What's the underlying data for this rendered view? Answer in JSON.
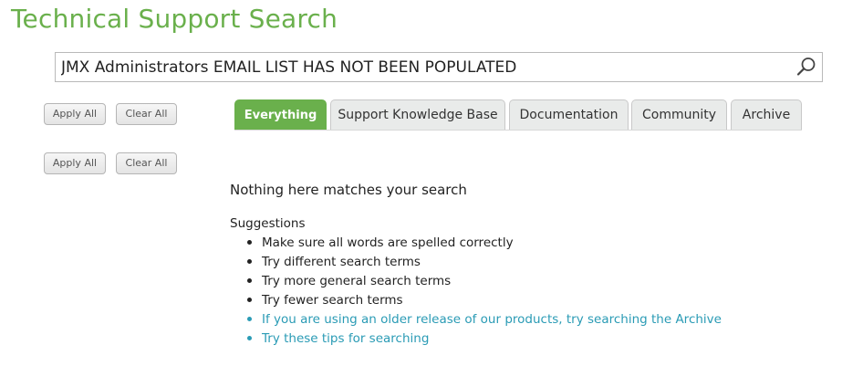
{
  "page": {
    "title": "Technical Support Search"
  },
  "search": {
    "value": "JMX Administrators EMAIL LIST HAS NOT BEEN POPULATED",
    "icon": "search-icon"
  },
  "filters": [
    {
      "apply_label": "Apply All",
      "clear_label": "Clear All"
    },
    {
      "apply_label": "Apply All",
      "clear_label": "Clear All"
    }
  ],
  "tabs": [
    {
      "label": "Everything",
      "active": true
    },
    {
      "label": "Support Knowledge Base",
      "active": false
    },
    {
      "label": "Documentation",
      "active": false
    },
    {
      "label": "Community",
      "active": false
    },
    {
      "label": "Archive",
      "active": false
    }
  ],
  "results": {
    "empty_message": "Nothing here matches your search",
    "suggestions_label": "Suggestions",
    "suggestions": [
      "Make sure all words are spelled correctly",
      "Try different search terms",
      "Try more general search terms",
      "Try fewer search terms"
    ],
    "links": [
      "If you are using an older release of our products, try searching the Archive",
      "Try these tips for searching"
    ]
  },
  "colors": {
    "brand_green": "#6ab04c",
    "link_teal": "#2a9bb5",
    "tab_bg": "#e9ebea"
  }
}
